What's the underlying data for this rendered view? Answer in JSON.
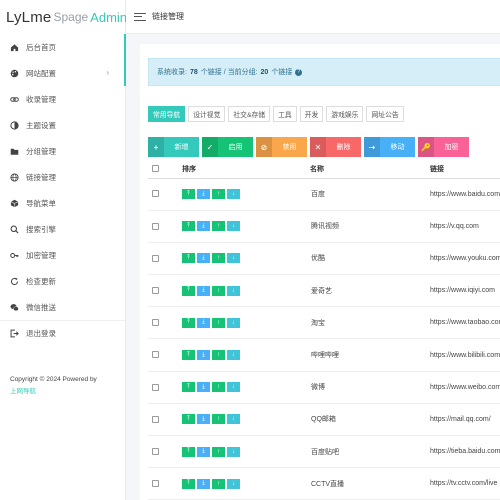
{
  "logo": {
    "part1": "LyLme",
    "part2": "Spage",
    "part3": "Admin"
  },
  "sidebar": {
    "items": [
      {
        "label": "后台首页",
        "icon": "home-icon"
      },
      {
        "label": "网站配置",
        "icon": "palette-icon",
        "arrow": "›"
      },
      {
        "label": "收录管理",
        "icon": "link-icon"
      },
      {
        "label": "主题设置",
        "icon": "theme-icon"
      },
      {
        "label": "分组管理",
        "icon": "folder-icon"
      },
      {
        "label": "链接管理",
        "icon": "globe-icon"
      },
      {
        "label": "导航菜单",
        "icon": "cube-icon"
      },
      {
        "label": "搜索引擎",
        "icon": "search-icon"
      },
      {
        "label": "加密管理",
        "icon": "key-icon"
      },
      {
        "label": "检查更新",
        "icon": "refresh-icon"
      },
      {
        "label": "微信推送",
        "icon": "wechat-icon"
      },
      {
        "label": "退出登录",
        "icon": "logout-icon"
      }
    ],
    "footer_text": "Copyright © 2024 Powered by",
    "footer_link": "上网导航"
  },
  "topbar": {
    "title": "链接管理"
  },
  "alert": {
    "prefix": "系统收录:",
    "count": "78",
    "mid": "个链接 / 当前分组:",
    "group_count": "20",
    "suffix": "个链接",
    "icon": "question-icon"
  },
  "groups": [
    "常用导航",
    "设计视觉",
    "社交&存储",
    "工具",
    "开发",
    "游戏娱乐",
    "网址公告"
  ],
  "actions": [
    {
      "label": "新增",
      "icon_glyph": "+",
      "icon": "plus-icon",
      "color": "#33cabb"
    },
    {
      "label": "启用",
      "icon_glyph": "✓",
      "icon": "check-icon",
      "color": "#15c377"
    },
    {
      "label": "禁用",
      "icon_glyph": "⊘",
      "icon": "ban-icon",
      "color": "#faa64b"
    },
    {
      "label": "删除",
      "icon_glyph": "✕",
      "icon": "close-icon",
      "color": "#f96868"
    },
    {
      "label": "移动",
      "icon_glyph": "⇢",
      "icon": "move-icon",
      "color": "#48b0f7"
    },
    {
      "label": "加密",
      "icon_glyph": "🔑",
      "icon": "key-icon",
      "color": "#f96197"
    }
  ],
  "table": {
    "headers": {
      "sort": "排序",
      "name": "名称",
      "url": "链接"
    },
    "rows": [
      {
        "name": "百度",
        "url": "https://www.baidu.com"
      },
      {
        "name": "腾讯视频",
        "url": "https://v.qq.com"
      },
      {
        "name": "优酷",
        "url": "https://www.youku.com"
      },
      {
        "name": "爱奇艺",
        "url": "https://www.iqiyi.com"
      },
      {
        "name": "淘宝",
        "url": "https://www.taobao.com"
      },
      {
        "name": "哔哩哔哩",
        "url": "https://www.bilibili.com"
      },
      {
        "name": "微博",
        "url": "https://www.weibo.com"
      },
      {
        "name": "QQ邮箱",
        "url": "https://mail.qq.com/"
      },
      {
        "name": "百度贴吧",
        "url": "https://tieba.baidu.com"
      },
      {
        "name": "CCTV直播",
        "url": "https://tv.cctv.com/live"
      }
    ]
  },
  "colors": {
    "accent": "#33cabb"
  }
}
